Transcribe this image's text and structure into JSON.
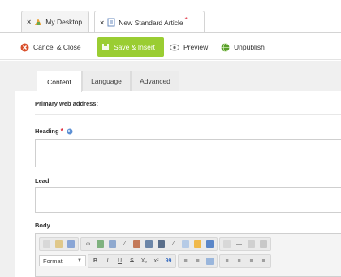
{
  "tabs": [
    {
      "close": "×",
      "label": "My Desktop"
    },
    {
      "close": "×",
      "label": "New Standard Article",
      "modified": "*"
    }
  ],
  "toolbar": {
    "cancel_label": "Cancel & Close",
    "save_label": "Save & Insert",
    "preview_label": "Preview",
    "unpublish_label": "Unpublish"
  },
  "form_tabs": [
    "Content",
    "Language",
    "Advanced"
  ],
  "fields": {
    "web_address_label": "Primary web address:",
    "heading_label": "Heading",
    "heading_required": "*",
    "heading_value": "",
    "lead_label": "Lead",
    "lead_value": "",
    "body_label": "Body"
  },
  "editor": {
    "format_select": "Format",
    "style_buttons": [
      "B",
      "I",
      "U",
      "S",
      "X₂",
      "x²",
      "99"
    ]
  },
  "colors": {
    "save_button": "#9acd32",
    "cancel_icon": "#d9502c",
    "unpublish_icon": "#5aa02c",
    "required": "#dd2233"
  }
}
